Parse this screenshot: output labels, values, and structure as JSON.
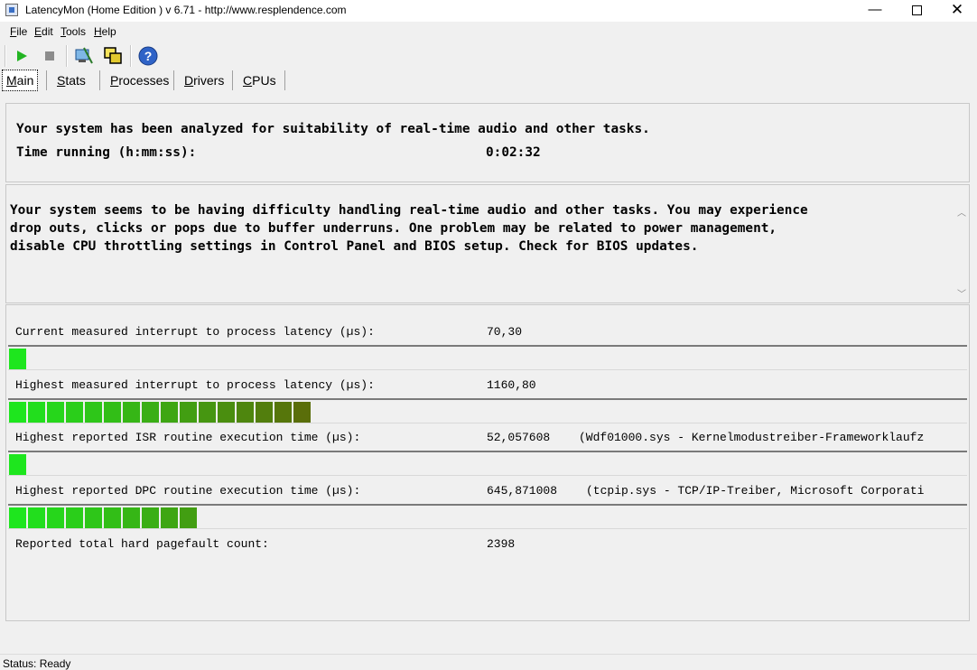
{
  "window": {
    "title": "LatencyMon  (Home Edition )  v 6.71 - http://www.resplendence.com",
    "minimize": "—",
    "close": "✕"
  },
  "menu": {
    "file": {
      "acc": "F",
      "rest": "ile"
    },
    "edit": {
      "acc": "E",
      "rest": "dit"
    },
    "tools": {
      "acc": "T",
      "rest": "ools"
    },
    "help": {
      "acc": "H",
      "rest": "elp"
    }
  },
  "toolbar": {
    "icons": [
      "play-icon",
      "stop-icon",
      "analyze-icon",
      "windows-icon",
      "help-icon"
    ],
    "play_color": "#22b422",
    "stop_color": "#8c8c8c",
    "help_color": "#2f63c7"
  },
  "tabs": [
    {
      "acc": "M",
      "rest": "ain"
    },
    {
      "acc": "S",
      "rest": "tats"
    },
    {
      "acc": "P",
      "rest": "rocesses"
    },
    {
      "acc": "D",
      "rest": "rivers"
    },
    {
      "acc": "C",
      "rest": "PUs"
    }
  ],
  "summary": {
    "analyzed": "Your system has been analyzed for suitability of real-time audio and other tasks.",
    "time_label": "Time running (h:mm:ss):",
    "time_value": "0:02:32"
  },
  "verdict": {
    "line1": "Your system seems to be having difficulty handling real-time audio and other tasks. You may experience",
    "line2": "drop outs, clicks or pops due to buffer underruns. One problem may be related to power management,",
    "line3": "disable CPU throttling settings in Control Panel and BIOS setup. Check for BIOS updates."
  },
  "metrics": [
    {
      "label": "Current measured interrupt to process latency (µs):",
      "value": "70,30",
      "detail": "",
      "level_segments": 1
    },
    {
      "label": "Highest measured interrupt to process latency (µs):",
      "value": "1160,80",
      "detail": "",
      "level_segments": 16
    },
    {
      "label": "Highest reported ISR routine execution time (µs):",
      "value": "52,057608",
      "detail": "(Wdf01000.sys - Kernelmodustreiber-Frameworklaufz",
      "level_segments": 1
    },
    {
      "label": "Highest reported DPC routine execution time (µs):",
      "value": "645,871008",
      "detail": "(tcpip.sys - TCP/IP-Treiber, Microsoft Corporati",
      "level_segments": 10
    },
    {
      "label": "Reported total hard pagefault count:",
      "value": "2398",
      "detail": ""
    }
  ],
  "bar_colors": {
    "start": "#1ee61e",
    "end": "#5a6e0a"
  },
  "status": {
    "text": "Status: Ready"
  }
}
